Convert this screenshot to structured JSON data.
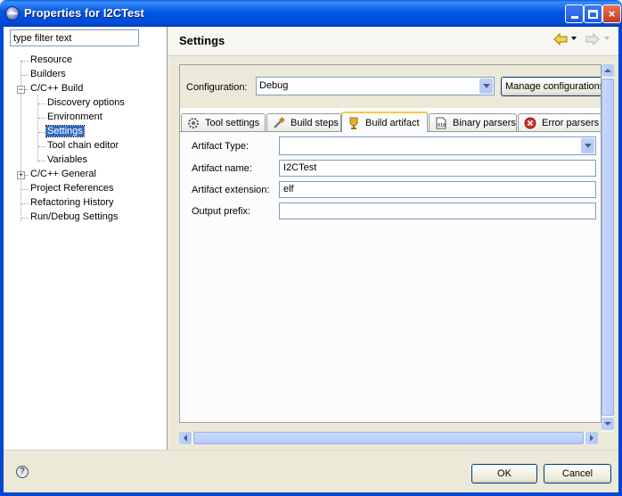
{
  "window": {
    "title": "Properties for I2CTest",
    "buttons": {
      "minimize": "minimize",
      "maximize": "maximize",
      "close": "×"
    }
  },
  "filter": {
    "value": "type filter text"
  },
  "tree": {
    "resource": "Resource",
    "builders": "Builders",
    "cpp_build": "C/C++ Build",
    "discovery_options": "Discovery options",
    "environment": "Environment",
    "settings": "Settings",
    "tool_chain_editor": "Tool chain editor",
    "variables": "Variables",
    "cpp_general": "C/C++ General",
    "project_references": "Project References",
    "refactoring_history": "Refactoring History",
    "run_debug_settings": "Run/Debug Settings"
  },
  "page": {
    "title": "Settings"
  },
  "configuration": {
    "label": "Configuration:",
    "value": "Debug",
    "manage_button": "Manage configurations..."
  },
  "tabs": {
    "tool_settings": "Tool settings",
    "build_steps": "Build steps",
    "build_artifact": "Build artifact",
    "binary_parsers": "Binary parsers",
    "error_parsers": "Error parsers"
  },
  "artifact": {
    "type_label": "Artifact Type:",
    "type_value": "",
    "name_label": "Artifact name:",
    "name_value": "I2CTest",
    "extension_label": "Artifact extension:",
    "extension_value": "elf",
    "prefix_label": "Output prefix:",
    "prefix_value": ""
  },
  "footer": {
    "help": "?",
    "ok": "OK",
    "cancel": "Cancel"
  },
  "colors": {
    "titlebar": "#0058e6",
    "selection": "#316ac5",
    "active_tab_accent": "#ffc83c",
    "window_bg": "#ece9d8"
  }
}
